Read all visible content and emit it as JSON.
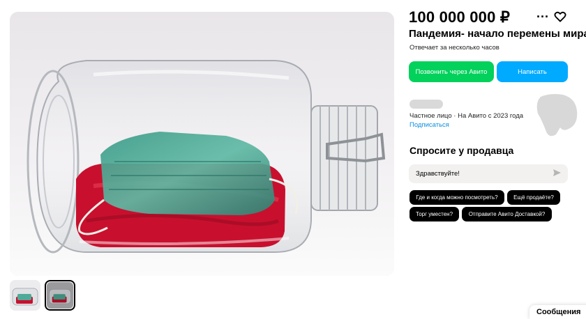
{
  "listing": {
    "price": "100 000 000 ₽",
    "title": "Пандемия- начало перемены мира",
    "reply_time": "Отвечает за несколько часов",
    "more_icon": "more-horizontal-icon",
    "favorite_icon": "heart-icon"
  },
  "actions": {
    "call_label": "Позвонить через Авито",
    "write_label": "Написать",
    "call_color": "#02d15c",
    "write_color": "#00aaff"
  },
  "seller": {
    "info": "Частное лицо · На Авито с 2023 года",
    "subscribe_label": "Подписаться"
  },
  "ask": {
    "title": "Спросите у продавца",
    "input_value": "Здравствуйте!",
    "send_icon": "send-icon",
    "quick_questions": [
      "Где и когда можно посмотреть?",
      "Ещё продаёте?",
      "Торг уместен?",
      "Отправите Авито Доставкой?"
    ]
  },
  "gallery": {
    "thumbnails_count": 2,
    "active_index": 1
  },
  "messenger": {
    "label": "Сообщения"
  }
}
